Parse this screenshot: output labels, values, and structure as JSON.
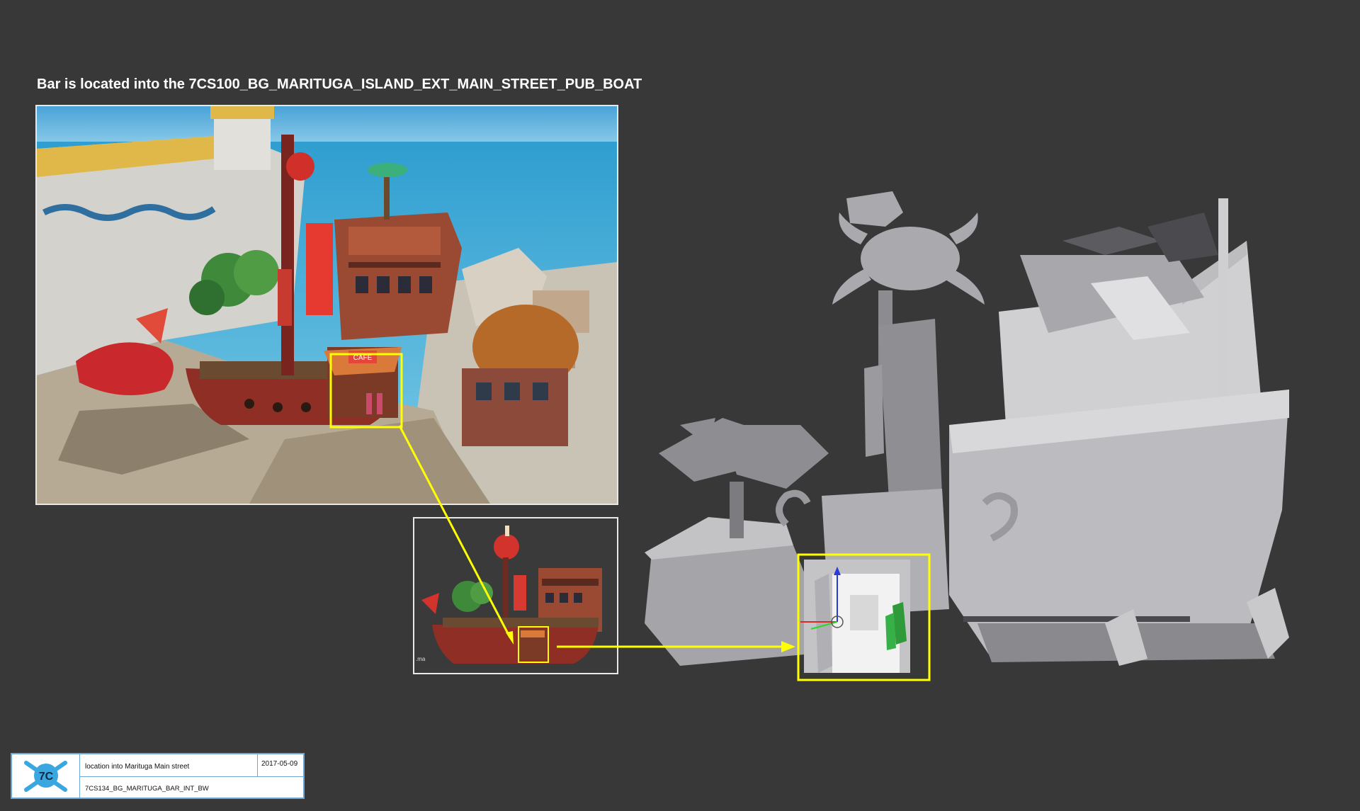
{
  "header": {
    "title": "Bar is located into the 7CS100_BG_MARITUGA_ISLAND_EXT_MAIN_STREET_PUB_BOAT"
  },
  "concept_art": {
    "sign_text": "CAFE"
  },
  "inset": {
    "file_label": ".ma"
  },
  "title_block": {
    "logo_text": "7C",
    "description": "location into Marituga Main street",
    "date": "2017-05-09",
    "filename": "7CS134_BG_MARITUGA_BAR_INT_BW"
  },
  "colors": {
    "background": "#383838",
    "highlight": "#ffff00",
    "title_block_border": "#6aa7d6"
  }
}
